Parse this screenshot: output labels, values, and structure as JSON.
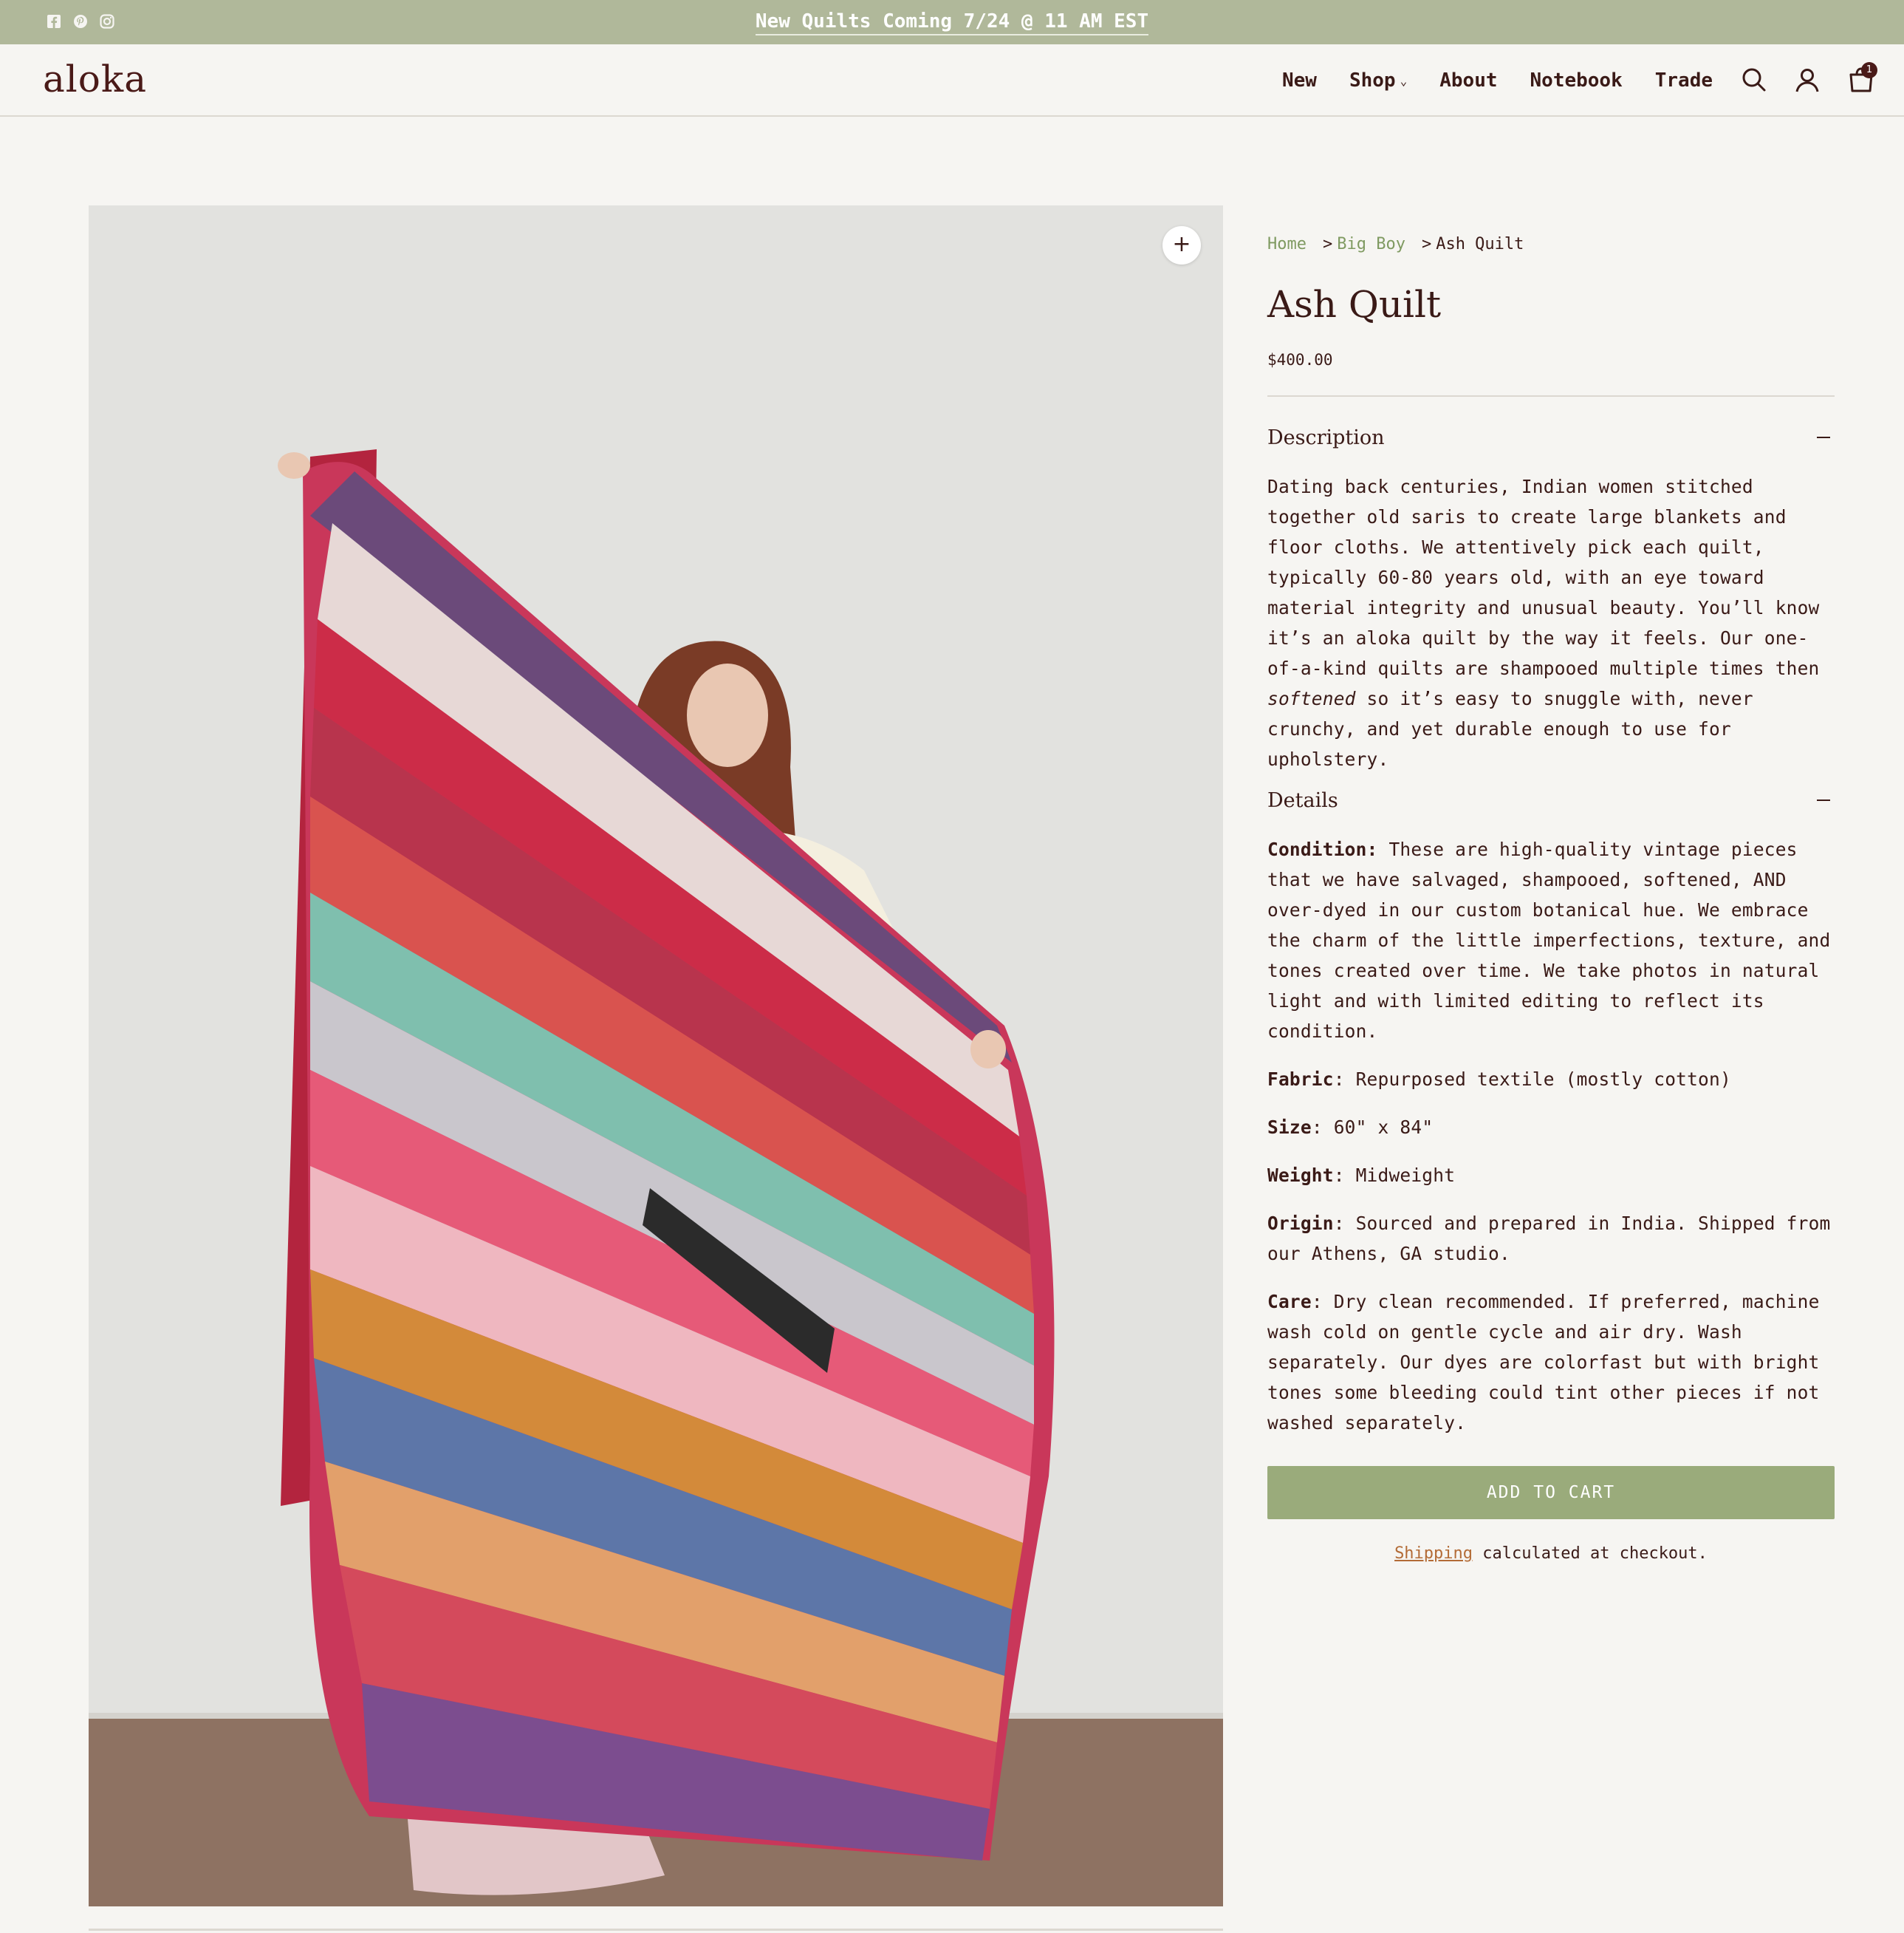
{
  "announcement": {
    "text": "New Quilts Coming 7/24 @ 11 AM EST"
  },
  "social": [
    "facebook-icon",
    "pinterest-icon",
    "instagram-icon"
  ],
  "header": {
    "logo": "aloka",
    "nav": [
      {
        "label": "New"
      },
      {
        "label": "Shop",
        "has_dropdown": true
      },
      {
        "label": "About"
      },
      {
        "label": "Notebook"
      },
      {
        "label": "Trade"
      }
    ],
    "icons": [
      "search-icon",
      "account-icon",
      "cart-icon"
    ],
    "cart_count": "1"
  },
  "breadcrumb": {
    "home": "Home",
    "sep1": ">",
    "category": "Big Boy",
    "sep2": ">",
    "current": "Ash Quilt"
  },
  "product": {
    "title": "Ash Quilt",
    "price": "$400.00",
    "description_heading": "Description",
    "description": {
      "before_em": "Dating back centuries, Indian women stitched together old saris to create large blankets and floor cloths. We attentively pick each quilt, typically 60-80 years old, with an eye toward material integrity and unusual beauty. You’ll know it’s an aloka quilt by the way it feels. Our one-of-a-kind quilts are shampooed multiple times then ",
      "em": "softened",
      "after_em": " so it’s easy to snuggle with, never crunchy, and yet durable enough to use for upholstery."
    },
    "details_heading": "Details",
    "details": [
      {
        "label": "Condition:",
        "text": " These are high-quality vintage pieces that we have salvaged, shampooed, softened, AND over-dyed in our custom botanical hue. We embrace the charm of the little imperfections, texture, and tones created over time. We take photos in natural light and with limited editing to reflect its condition."
      },
      {
        "label": "Fabric",
        "text": ": Repurposed textile (mostly cotton)"
      },
      {
        "label": "Size",
        "text": ": 60\" x 84\""
      },
      {
        "label": "Weight",
        "text": ": Midweight"
      },
      {
        "label": "Origin",
        "text": ": Sourced and prepared in India. Shipped from our Athens, GA studio."
      },
      {
        "label": "Care",
        "text": ": Dry clean recommended. If preferred, machine wash cold on gentle cycle and air dry. Wash separately. Our dyes are colorfast but with bright tones some bleeding could tint other pieces if not washed separately."
      }
    ],
    "add_to_cart": "ADD TO CART",
    "shipping_link": "Shipping",
    "shipping_text": " calculated at checkout."
  },
  "gallery": {
    "zoom_icon": "plus-icon",
    "zoom_label": "+"
  },
  "colors": {
    "topbar": "#b0b89a",
    "accent_green": "#9aab7b",
    "link_green": "#7f9a61",
    "link_orange": "#b36b36",
    "text": "#3a1a17"
  }
}
